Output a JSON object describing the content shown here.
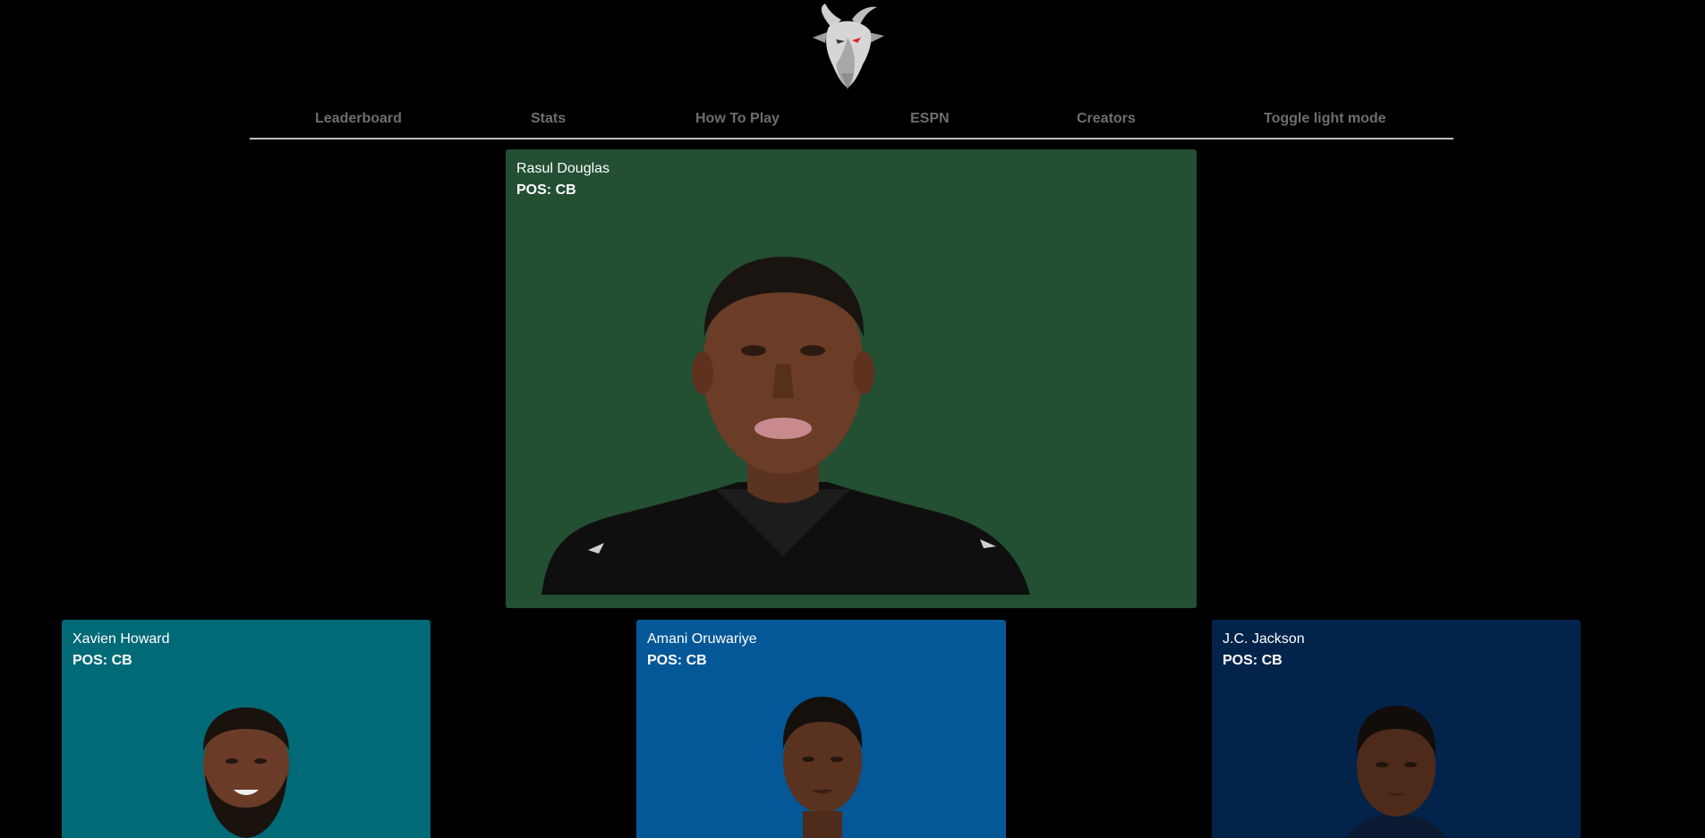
{
  "logo": {
    "icon": "goat-head-icon"
  },
  "nav": {
    "items": [
      {
        "label": "Leaderboard"
      },
      {
        "label": "Stats"
      },
      {
        "label": "How To Play"
      },
      {
        "label": "ESPN"
      },
      {
        "label": "Creators"
      },
      {
        "label": "Toggle light mode"
      }
    ]
  },
  "featured": {
    "name": "Rasul Douglas",
    "pos": "POS: CB",
    "color": "#234f33"
  },
  "players": [
    {
      "name": "Xavien Howard",
      "pos": "POS: CB",
      "color": "#006a77"
    },
    {
      "name": "Amani Oruwariye",
      "pos": "POS: CB",
      "color": "#045897"
    },
    {
      "name": "J.C. Jackson",
      "pos": "POS: CB",
      "color": "#03244a"
    }
  ]
}
